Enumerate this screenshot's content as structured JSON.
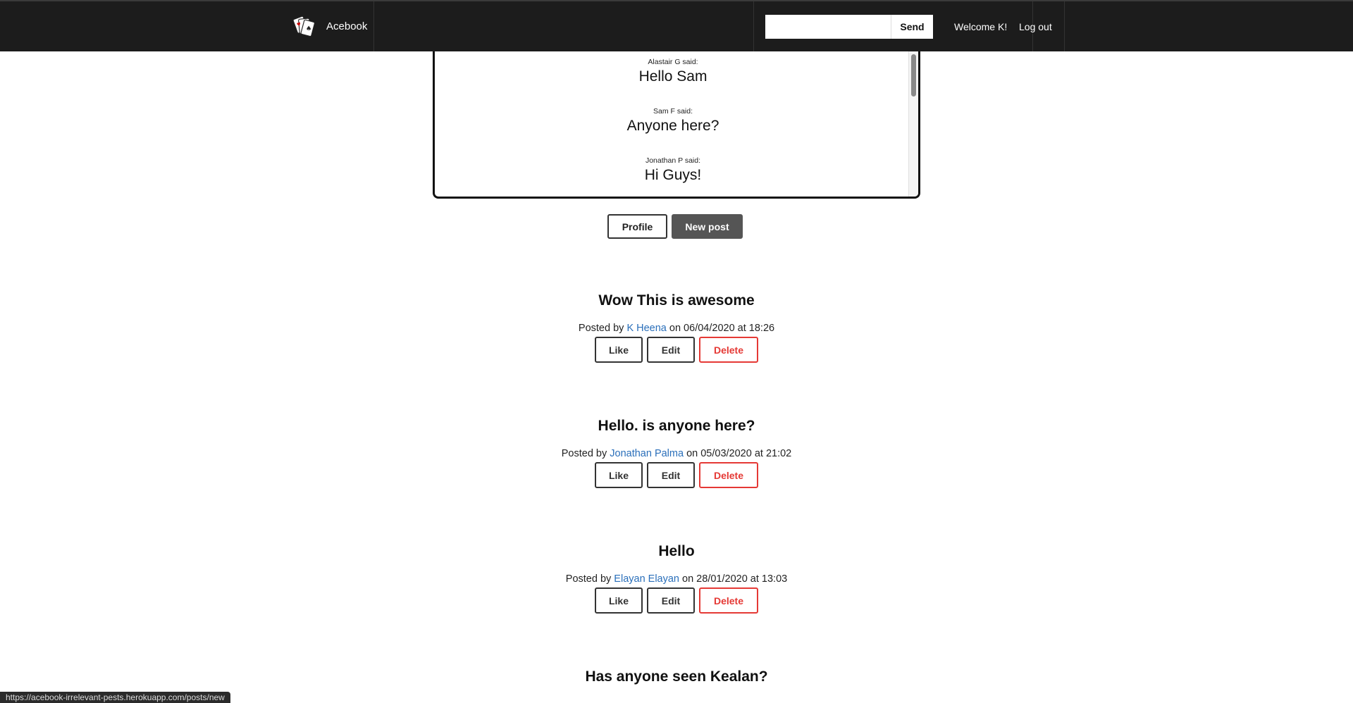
{
  "navbar": {
    "brand": "Acebook",
    "logo_icon": "playing-cards-icon",
    "search_placeholder": "",
    "send_label": "Send",
    "welcome": "Welcome K!",
    "logout": "Log out"
  },
  "chat": {
    "messages": [
      {
        "author": "Alastair G said:",
        "text": "Hello Sam"
      },
      {
        "author": "Sam F said:",
        "text": "Anyone here?"
      },
      {
        "author": "Jonathan P said:",
        "text": "Hi Guys!"
      }
    ]
  },
  "actions": {
    "profile": "Profile",
    "new_post": "New post"
  },
  "posts": [
    {
      "title": "Wow This is awesome",
      "prefix": "Posted by ",
      "author": "K Heena",
      "date": " on 06/04/2020 at 18:26",
      "like": "Like",
      "edit": "Edit",
      "delete": "Delete"
    },
    {
      "title": "Hello. is anyone here?",
      "prefix": "Posted by ",
      "author": "Jonathan Palma",
      "date": " on 05/03/2020 at 21:02",
      "like": "Like",
      "edit": "Edit",
      "delete": "Delete"
    },
    {
      "title": "Hello",
      "prefix": "Posted by ",
      "author": "Elayan Elayan",
      "date": " on 28/01/2020 at 13:03",
      "like": "Like",
      "edit": "Edit",
      "delete": "Delete"
    },
    {
      "title": "Has anyone seen Kealan?"
    }
  ],
  "status_url": "https://acebook-irrelevant-pests.herokuapp.com/posts/new",
  "colors": {
    "navbar_bg": "#1c1c1c",
    "link": "#2a6fba",
    "delete": "#e53935",
    "new_post_bg": "#555555"
  }
}
